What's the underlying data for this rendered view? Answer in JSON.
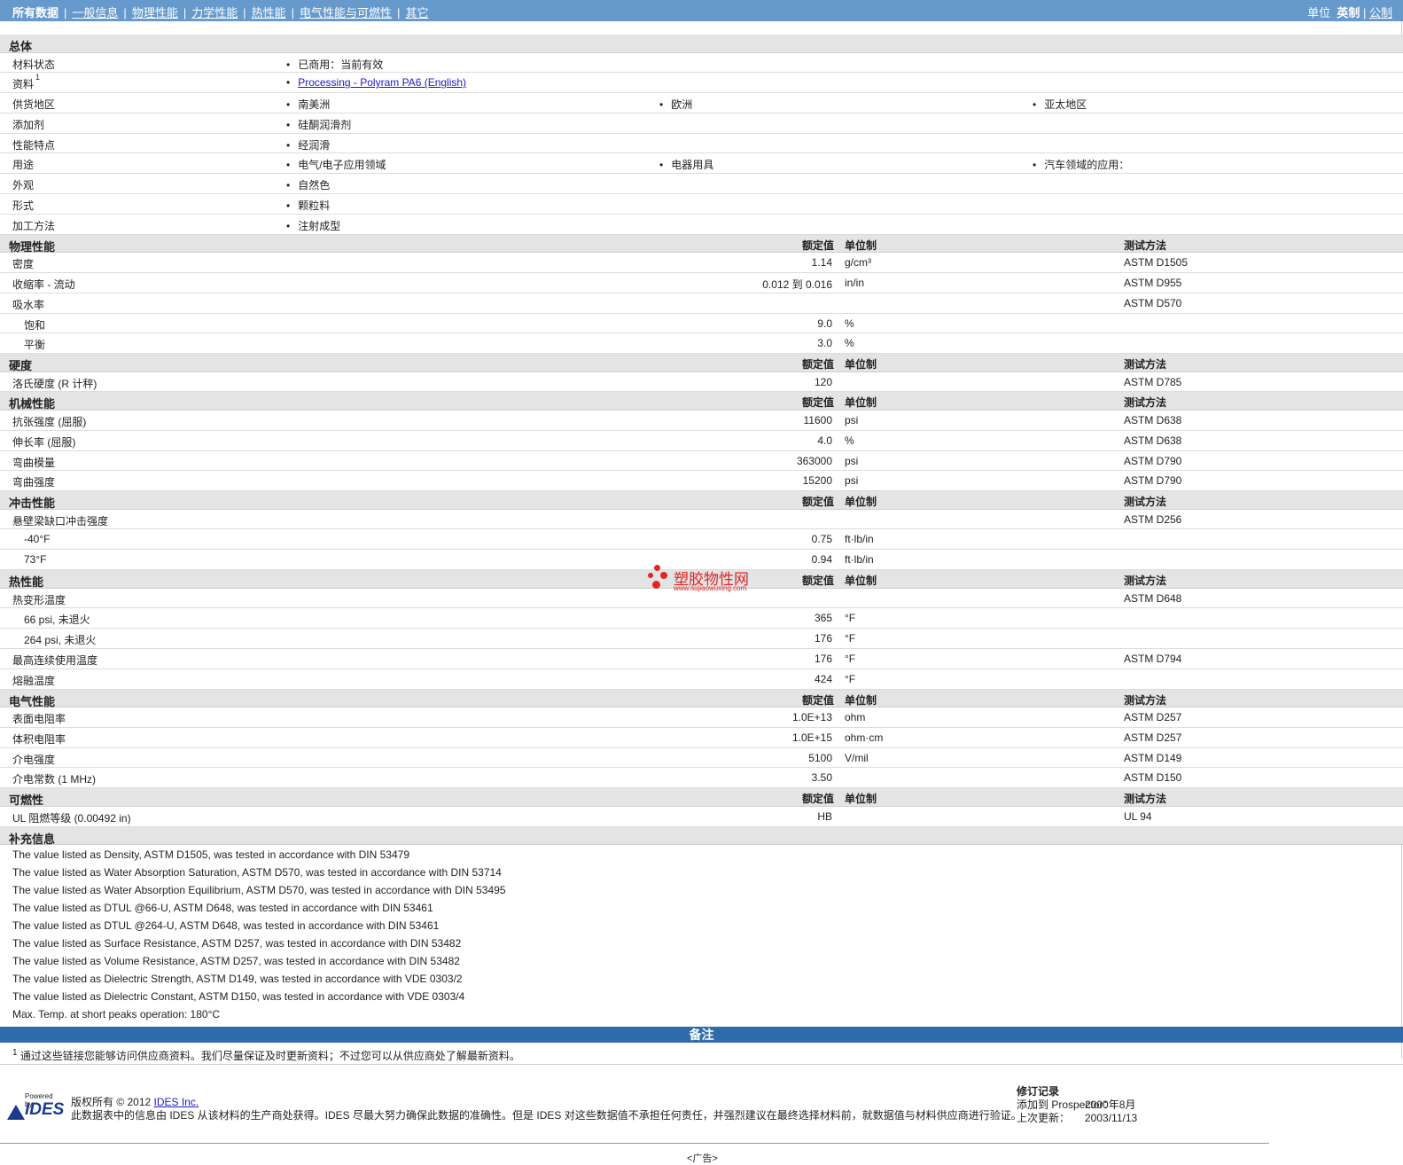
{
  "nav": {
    "tabs": [
      "所有数据",
      "一般信息",
      "物理性能",
      "力学性能",
      "热性能",
      "电气性能与可燃性",
      "其它"
    ],
    "units_label": "单位",
    "units_en": "英制",
    "units_sep": "|",
    "units_metric": "公制"
  },
  "headers": {
    "value": "额定值",
    "unit": "单位制",
    "test": "测试方法"
  },
  "general": {
    "title": "总体",
    "rows": [
      {
        "label": "材料状态",
        "sup": "",
        "items": [
          "已商用：当前有效"
        ]
      },
      {
        "label": "资料",
        "sup": "1",
        "items": [
          "Processing - Polyram PA6 (English)"
        ],
        "link": true
      },
      {
        "label": "供货地区",
        "sup": "",
        "items": [
          "南美洲",
          "欧洲",
          "亚太地区"
        ]
      },
      {
        "label": "添加剂",
        "sup": "",
        "items": [
          "硅酮润滑剂"
        ]
      },
      {
        "label": "性能特点",
        "sup": "",
        "items": [
          "经润滑"
        ]
      },
      {
        "label": "用途",
        "sup": "",
        "items": [
          "电气/电子应用领域",
          "电器用具",
          "汽车领域的应用："
        ]
      },
      {
        "label": "外观",
        "sup": "",
        "items": [
          "自然色"
        ]
      },
      {
        "label": "形式",
        "sup": "",
        "items": [
          "颗粒料"
        ]
      },
      {
        "label": "加工方法",
        "sup": "",
        "items": [
          "注射成型"
        ]
      }
    ]
  },
  "sections": [
    {
      "title": "物理性能",
      "rows": [
        {
          "label": "密度",
          "sub": false,
          "value": "1.14",
          "unit": "g/cm³",
          "test": "ASTM D1505"
        },
        {
          "label": "收缩率 - 流动",
          "sub": false,
          "value": "0.012 到  0.016",
          "unit": "in/in",
          "test": "ASTM D955"
        },
        {
          "label": "吸水率",
          "sub": false,
          "value": "",
          "unit": "",
          "test": "ASTM D570"
        },
        {
          "label": "饱和",
          "sub": true,
          "value": "9.0",
          "unit": "%",
          "test": ""
        },
        {
          "label": "平衡",
          "sub": true,
          "value": "3.0",
          "unit": "%",
          "test": ""
        }
      ]
    },
    {
      "title": "硬度",
      "rows": [
        {
          "label": "洛氏硬度 (R 计秤)",
          "sub": false,
          "value": "120",
          "unit": "",
          "test": "ASTM D785"
        }
      ]
    },
    {
      "title": "机械性能",
      "rows": [
        {
          "label": "抗张强度 (屈服)",
          "sub": false,
          "value": "11600",
          "unit": "psi",
          "test": "ASTM D638"
        },
        {
          "label": "伸长率 (屈服)",
          "sub": false,
          "value": "4.0",
          "unit": "%",
          "test": "ASTM D638"
        },
        {
          "label": "弯曲模量",
          "sub": false,
          "value": "363000",
          "unit": "psi",
          "test": "ASTM D790"
        },
        {
          "label": "弯曲强度",
          "sub": false,
          "value": "15200",
          "unit": "psi",
          "test": "ASTM D790"
        }
      ]
    },
    {
      "title": "冲击性能",
      "rows": [
        {
          "label": "悬壁梁缺口冲击强度",
          "sub": false,
          "value": "",
          "unit": "",
          "test": "ASTM D256"
        },
        {
          "label": "-40°F",
          "sub": true,
          "value": "0.75",
          "unit": "ft·lb/in",
          "test": ""
        },
        {
          "label": "73°F",
          "sub": true,
          "value": "0.94",
          "unit": "ft·lb/in",
          "test": ""
        }
      ]
    },
    {
      "title": "热性能",
      "rows": [
        {
          "label": "热变形温度",
          "sub": false,
          "value": "",
          "unit": "",
          "test": "ASTM D648"
        },
        {
          "label": "66 psi, 未退火",
          "sub": true,
          "value": "365",
          "unit": "°F",
          "test": ""
        },
        {
          "label": "264 psi, 未退火",
          "sub": true,
          "value": "176",
          "unit": "°F",
          "test": ""
        },
        {
          "label": "最高连续使用温度",
          "sub": false,
          "value": "176",
          "unit": "°F",
          "test": "ASTM D794"
        },
        {
          "label": "熔融温度",
          "sub": false,
          "value": "424",
          "unit": "°F",
          "test": ""
        }
      ]
    },
    {
      "title": "电气性能",
      "rows": [
        {
          "label": "表面电阻率",
          "sub": false,
          "value": "1.0E+13",
          "unit": "ohm",
          "test": "ASTM D257"
        },
        {
          "label": "体积电阻率",
          "sub": false,
          "value": "1.0E+15",
          "unit": "ohm·cm",
          "test": "ASTM D257"
        },
        {
          "label": "介电强度",
          "sub": false,
          "value": "5100",
          "unit": "V/mil",
          "test": "ASTM D149"
        },
        {
          "label": "介电常数 (1 MHz)",
          "sub": false,
          "value": "3.50",
          "unit": "",
          "test": "ASTM D150"
        }
      ]
    },
    {
      "title": "可燃性",
      "rows": [
        {
          "label": "UL 阻燃等级 (0.00492 in)",
          "sub": false,
          "value": "HB",
          "unit": "",
          "test": "UL 94"
        }
      ]
    }
  ],
  "supplement": {
    "title": "补充信息",
    "notes": [
      "The value listed as Density, ASTM D1505, was tested in accordance with DIN 53479",
      "The value listed as Water Absorption Saturation, ASTM D570, was tested in accordance with DIN 53714",
      "The value listed as Water Absorption Equilibrium, ASTM D570, was tested in accordance with DIN 53495",
      "The value listed as DTUL @66-U, ASTM D648, was tested in accordance with DIN 53461",
      "The value listed as DTUL @264-U, ASTM D648, was tested in accordance with DIN 53461",
      "The value listed as Surface Resistance, ASTM D257, was tested in accordance with DIN 53482",
      "The value listed as Volume Resistance, ASTM D257, was tested in accordance with DIN 53482",
      "The value listed as Dielectric Strength, ASTM D149, was tested in accordance with VDE 0303/2",
      "The value listed as Dielectric Constant, ASTM D150, was tested in accordance with VDE 0303/4",
      "Max. Temp. at short peaks operation: 180°C"
    ]
  },
  "notes": {
    "title": "备注",
    "footnote_num": "1",
    "footnote": "通过这些链接您能够访问供应商资料。我们尽量保证及时更新资料；不过您可以从供应商处了解最新资料。"
  },
  "footer": {
    "logo_small": "Powered by",
    "logo_text": "IDES",
    "copyright_prefix": "版权所有 © 2012 ",
    "copyright_link": "IDES Inc.",
    "disclaimer": "此数据表中的信息由 IDES 从该材料的生产商处获得。IDES 尽最大努力确保此数据的准确性。但是 IDES 对这些数据值不承担任何责任，并强烈建议在最终选择材料前，就数据值与材料供应商进行验证。",
    "rev_title": "修订记录",
    "added_label": "添加到 Prospector：",
    "added_value": "2000年8月",
    "updated_label": "上次更新：",
    "updated_value": "2003/11/13",
    "ad": "<广告>"
  },
  "watermark": {
    "text": "塑胶物性网",
    "url": "www.sujiaowuxing.com"
  }
}
